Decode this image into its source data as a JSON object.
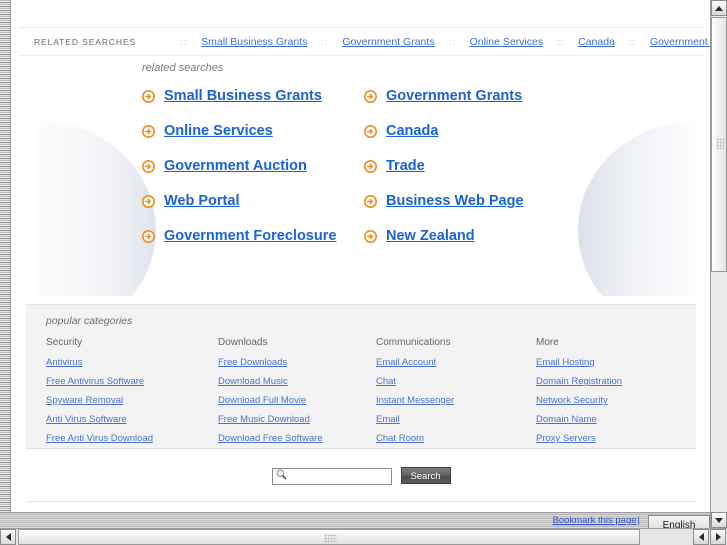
{
  "related_bar": {
    "label": "RELATED SEARCHES",
    "separator": "::",
    "links": [
      "Small Business Grants",
      "Government Grants",
      "Online Services",
      "Canada",
      "Government Auction"
    ]
  },
  "hero": {
    "caption": "related searches",
    "arrow_icon": "circle-arrow-right-icon",
    "accent_color": "#f08a1c",
    "link_color": "#1a62d6",
    "items": [
      "Small Business Grants",
      "Government Grants",
      "Online Services",
      "Canada",
      "Government Auction",
      "Trade",
      "Web Portal",
      "Business Web Page",
      "Government Foreclosure",
      "New Zealand"
    ]
  },
  "categories": {
    "caption": "popular categories",
    "columns": [
      {
        "heading": "Security",
        "links": [
          "Antivirus",
          "Free Antivirus Software",
          "Spyware Removal",
          "Anti Virus Software",
          "Free Anti Virus Download"
        ]
      },
      {
        "heading": "Downloads",
        "links": [
          "Free Downloads",
          "Download Music",
          "Download Full Movie",
          "Free Music Download",
          "Download Free Software"
        ]
      },
      {
        "heading": "Communications",
        "links": [
          "Email Account",
          "Chat",
          "Instant Messenger",
          "Email",
          "Chat Room"
        ]
      },
      {
        "heading": "More",
        "links": [
          "Email Hosting",
          "Domain Registration",
          "Network Security",
          "Domain Name",
          "Proxy Servers"
        ]
      }
    ]
  },
  "search": {
    "value": "",
    "placeholder": "",
    "icon": "magnifier-icon",
    "button_label": "Search"
  },
  "statusbar": {
    "bookmark_label": "Bookmark this page",
    "pipe": "|",
    "language_value": "English"
  },
  "scrollbars": {
    "v_up_icon": "triangle-up-icon",
    "v_down_icon": "triangle-down-icon",
    "h_left_icon": "triangle-left-icon",
    "h_right_icon": "triangle-right-icon"
  }
}
